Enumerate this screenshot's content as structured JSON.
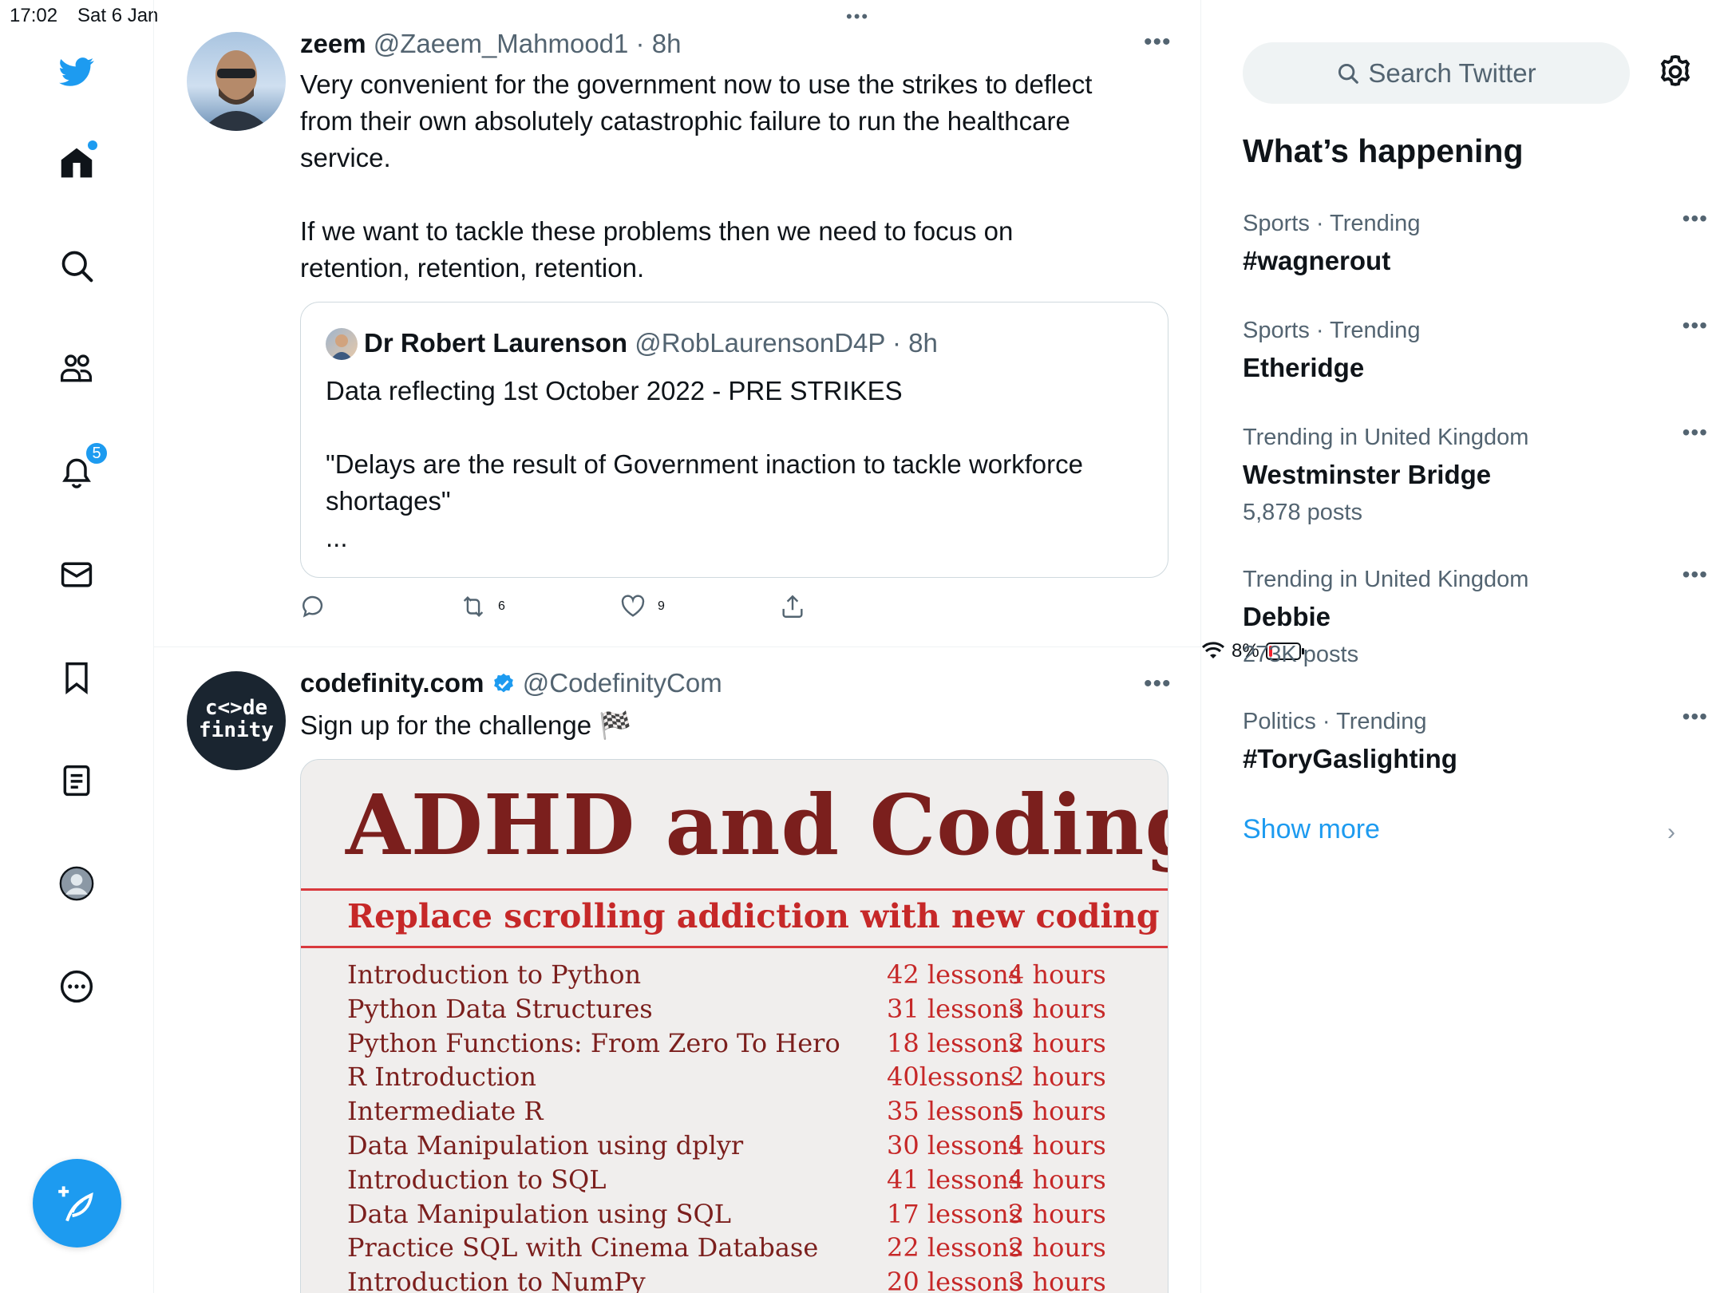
{
  "status_bar": {
    "time": "17:02",
    "date": "Sat 6 Jan",
    "battery": "8%"
  },
  "nav": {
    "items": [
      "twitter-logo",
      "home-icon",
      "explore-icon",
      "communities-icon",
      "notifications-icon",
      "messages-icon",
      "bookmarks-icon",
      "lists-icon",
      "profile-icon",
      "more-icon"
    ],
    "notifications_badge": "5",
    "accent": "#1d9bf0"
  },
  "feed": {
    "tweets": [
      {
        "name": "zeem",
        "handle": "@Zaeem_Mahmood1 · 8h",
        "text": "Very convenient for the government now to use the strikes to deflect\nfrom their own absolutely catastrophic failure to run the healthcare\nservice.\n\nIf we want to tackle these problems then we need to focus on\nretention, retention, retention.",
        "quote": {
          "name": "Dr Robert Laurenson",
          "handle": "@RobLaurensonD4P · 8h",
          "text": "Data reflecting 1st October 2022 - PRE STRIKES\n\n\"Delays are the result of Government inaction to tackle workforce\nshortages\"\n..."
        },
        "retweets": "6",
        "likes": "9"
      },
      {
        "name": "codefinity.com",
        "handle": "@CodefinityCom",
        "text": "Sign up for the challenge 🏁",
        "avatar_text": [
          "c<>de",
          "finity"
        ]
      }
    ],
    "promo": {
      "title": "ADHD and Coding",
      "subtitle": "Replace scrolling addiction with new coding skills",
      "courses": [
        {
          "course": "Introduction to Python",
          "lessons": "42 lessons",
          "hours": "4 hours"
        },
        {
          "course": "Python Data Structures",
          "lessons": "31 lessons",
          "hours": "3 hours"
        },
        {
          "course": "Python Functions: From Zero To Hero",
          "lessons": "18 lessons",
          "hours": "2 hours"
        },
        {
          "course": "R Introduction",
          "lessons": "40lessons",
          "hours": "2 hours"
        },
        {
          "course": "Intermediate R",
          "lessons": "35 lessons",
          "hours": "5 hours"
        },
        {
          "course": "Data Manipulation using dplyr",
          "lessons": "30 lessons",
          "hours": "4 hours"
        },
        {
          "course": "Introduction to SQL",
          "lessons": "41 lessons",
          "hours": "4 hours"
        },
        {
          "course": "Data Manipulation using SQL",
          "lessons": "17 lessons",
          "hours": "2 hours"
        },
        {
          "course": "Practice SQL with Cinema Database",
          "lessons": "22 lessons",
          "hours": "2 hours"
        },
        {
          "course": "Introduction to NumPy",
          "lessons": "20 lessons",
          "hours": "3 hours"
        }
      ]
    }
  },
  "sidebar": {
    "search_placeholder": "Search Twitter",
    "whats_happening": "What’s happening",
    "trends": [
      {
        "context": "Sports · Trending",
        "topic": "#wagnerout",
        "count": ""
      },
      {
        "context": "Sports · Trending",
        "topic": "Etheridge",
        "count": ""
      },
      {
        "context": "Trending in United Kingdom",
        "topic": "Westminster Bridge",
        "count": "5,878 posts"
      },
      {
        "context": "Trending in United Kingdom",
        "topic": "Debbie",
        "count": "273K posts"
      },
      {
        "context": "Politics · Trending",
        "topic": "#ToryGaslighting",
        "count": ""
      }
    ],
    "show_more": "Show more"
  }
}
